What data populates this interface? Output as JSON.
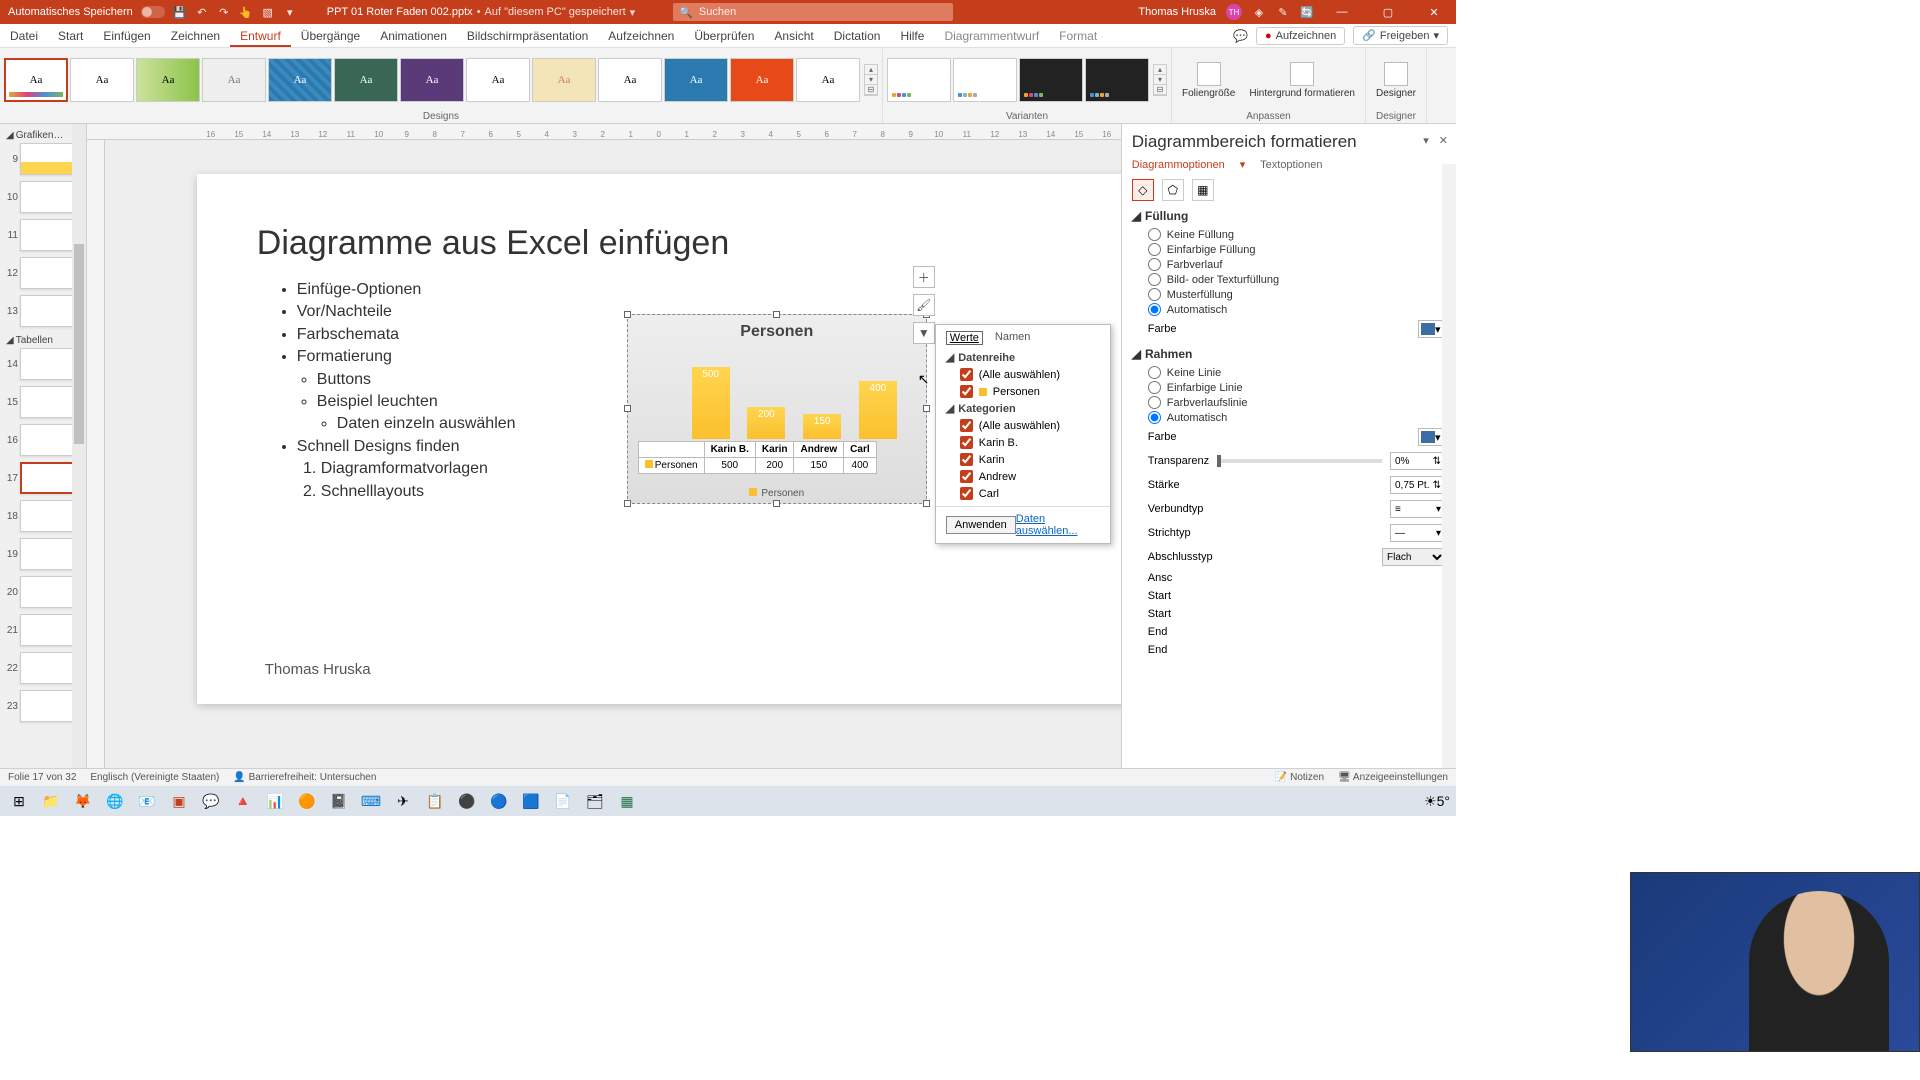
{
  "titlebar": {
    "autosave": "Automatisches Speichern",
    "filename": "PPT 01 Roter Faden 002.pptx",
    "saved_hint": "Auf \"diesem PC\" gespeichert",
    "search_placeholder": "Suchen",
    "user": "Thomas Hruska",
    "user_initials": "TH"
  },
  "menu": {
    "tabs": [
      "Datei",
      "Start",
      "Einfügen",
      "Zeichnen",
      "Entwurf",
      "Übergänge",
      "Animationen",
      "Bildschirmpräsentation",
      "Aufzeichnen",
      "Überprüfen",
      "Ansicht",
      "Dictation",
      "Hilfe",
      "Diagrammentwurf",
      "Format"
    ],
    "active": "Entwurf",
    "record": "Aufzeichnen",
    "share": "Freigeben"
  },
  "ribbon": {
    "designs_label": "Designs",
    "variants_label": "Varianten",
    "customize_label": "Anpassen",
    "slidesize": "Foliengröße",
    "formatbg": "Hintergrund formatieren",
    "designer_group": "Designer",
    "designer_btn": "Designer"
  },
  "thumbs": {
    "section1": "Grafiken…",
    "section2": "Tabellen",
    "slides": [
      {
        "n": "9"
      },
      {
        "n": "10"
      },
      {
        "n": "11"
      },
      {
        "n": "12"
      },
      {
        "n": "13"
      },
      {
        "n": "14"
      },
      {
        "n": "15"
      },
      {
        "n": "16"
      },
      {
        "n": "17",
        "active": true
      },
      {
        "n": "18"
      },
      {
        "n": "19"
      },
      {
        "n": "20"
      },
      {
        "n": "21"
      },
      {
        "n": "22"
      },
      {
        "n": "23"
      }
    ]
  },
  "slide": {
    "title": "Diagramme aus Excel einfügen",
    "bullets": {
      "b1": "Einfüge-Optionen",
      "b2": "Vor/Nachteile",
      "b3": "Farbschemata",
      "b4": "Formatierung",
      "b4a": "Buttons",
      "b4b": "Beispiel leuchten",
      "b4b1": "Daten einzeln auswählen",
      "b5": "Schnell Designs finden",
      "b5n1": "Diagramformatvorlagen",
      "b5n2": "Schnelllayouts"
    },
    "author": "Thomas Hruska"
  },
  "chart_data": {
    "type": "bar",
    "title": "Personen",
    "categories": [
      "Karin B.",
      "Karin",
      "Andrew",
      "Carl"
    ],
    "series": [
      {
        "name": "Personen",
        "values": [
          500,
          200,
          150,
          400
        ]
      }
    ],
    "legend": "Personen",
    "row_label": "Personen"
  },
  "filter_flyout": {
    "tab_values": "Werte",
    "tab_names": "Namen",
    "series_header": "Datenreihe",
    "select_all": "(Alle auswählen)",
    "series_item": "Personen",
    "categories_header": "Kategorien",
    "cat_items": [
      "Karin B.",
      "Karin",
      "Andrew",
      "Carl"
    ],
    "apply": "Anwenden",
    "select_data": "Daten auswählen..."
  },
  "format_pane": {
    "title": "Diagrammbereich formatieren",
    "tab_chart": "Diagrammoptionen",
    "tab_text": "Textoptionen",
    "fill_header": "Füllung",
    "fill_none": "Keine Füllung",
    "fill_solid": "Einfarbige Füllung",
    "fill_grad": "Farbverlauf",
    "fill_pic": "Bild- oder Texturfüllung",
    "fill_pattern": "Musterfüllung",
    "fill_auto": "Automatisch",
    "color_label": "Farbe",
    "border_header": "Rahmen",
    "line_none": "Keine Linie",
    "line_solid": "Einfarbige Linie",
    "line_grad": "Farbverlaufslinie",
    "line_auto": "Automatisch",
    "transp": "Transparenz",
    "transp_val": "0%",
    "width": "Stärke",
    "width_val": "0,75 Pt.",
    "compound": "Verbundtyp",
    "dash": "Strichtyp",
    "cap": "Abschlusstyp",
    "cap_val": "Flach",
    "join": "Ansc",
    "arrow_start": "Start",
    "arrow_start2": "Start",
    "arrow_end": "End",
    "arrow_end2": "End"
  },
  "status": {
    "slide_info": "Folie 17 von 32",
    "lang": "Englisch (Vereinigte Staaten)",
    "access": "Barrierefreiheit: Untersuchen",
    "notes": "Notizen",
    "display": "Anzeigeeinstellungen"
  },
  "ruler": [
    "16",
    "15",
    "14",
    "13",
    "12",
    "11",
    "10",
    "9",
    "8",
    "7",
    "6",
    "5",
    "4",
    "3",
    "2",
    "1",
    "0",
    "1",
    "2",
    "3",
    "4",
    "5",
    "6",
    "7",
    "8",
    "9",
    "10",
    "11",
    "12",
    "13",
    "14",
    "15",
    "16"
  ],
  "taskbar": {
    "temp": "5°"
  }
}
